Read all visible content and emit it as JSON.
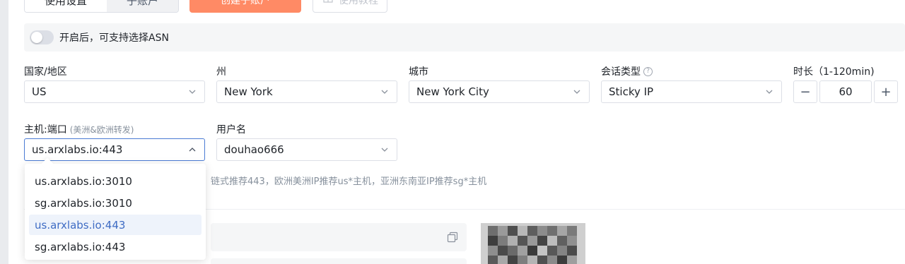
{
  "toolbar": {
    "tabs": [
      {
        "label": "使用设置",
        "active": true
      },
      {
        "label": "子账户",
        "active": false
      }
    ],
    "create_label": "创建子账户",
    "tutorial_label": "使用教程"
  },
  "asn": {
    "enabled": false,
    "label": "开启后，可支持选择ASN"
  },
  "fields": {
    "country": {
      "label": "国家/地区",
      "value": "US"
    },
    "state": {
      "label": "州",
      "value": "New York"
    },
    "city": {
      "label": "城市",
      "value": "New York City"
    },
    "session": {
      "label": "会话类型",
      "value": "Sticky IP"
    },
    "duration": {
      "label": "时长（1-120min)",
      "value": "60",
      "minus": "−",
      "plus": "+"
    },
    "host": {
      "label": "主机:端口",
      "sublabel": "(美洲&欧洲转发)",
      "value": "us.arxlabs.io:443"
    },
    "username": {
      "label": "用户名",
      "value": "douhao666"
    }
  },
  "host_options": [
    {
      "label": "us.arxlabs.io:3010",
      "selected": false
    },
    {
      "label": "sg.arxlabs.io:3010",
      "selected": false
    },
    {
      "label": "us.arxlabs.io:443",
      "selected": true
    },
    {
      "label": "sg.arxlabs.io:443",
      "selected": false
    }
  ],
  "hint": "链式推荐443，欧洲美洲IP推荐us*主机，亚洲东南亚IP推荐sg*主机",
  "icons": {
    "chevron": "chevron-down-icon",
    "help": "question-circle-icon",
    "copy": "copy-icon",
    "tutorial": "book-icon",
    "qr": "qr-code-image"
  },
  "colors": {
    "accent": "#4a7bd4",
    "primary_button": "#ff8a65",
    "selected_bg": "#eef3fb"
  }
}
